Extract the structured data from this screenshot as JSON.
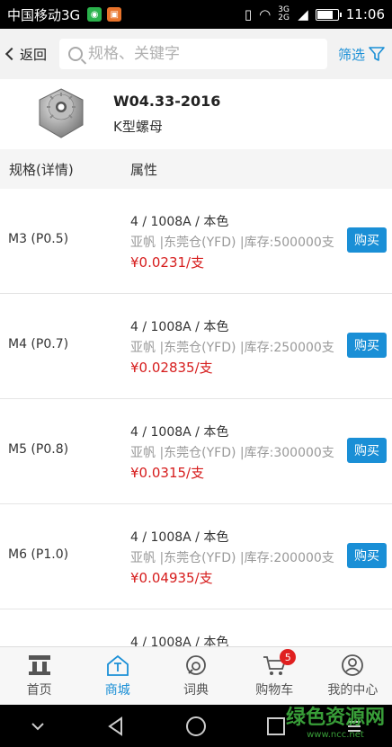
{
  "status": {
    "carrier": "中国移动3G",
    "network": "3G 2G",
    "time": "11:06",
    "battery_level": 0.8
  },
  "header": {
    "back_label": "返回",
    "search_placeholder": "规格、关键字",
    "filter_label": "筛选"
  },
  "product": {
    "code": "W04.33-2016",
    "name": "K型螺母"
  },
  "table": {
    "col_spec": "规格(详情)",
    "col_attr": "属性",
    "rows": [
      {
        "spec": "M3 (P0.5)",
        "attr": "4 / 1008A / 本色",
        "supplier": "亚帆 |东莞仓(YFD) |库存:500000支",
        "price": "¥0.0231/支",
        "buy": "购买"
      },
      {
        "spec": "M4 (P0.7)",
        "attr": "4 / 1008A / 本色",
        "supplier": "亚帆 |东莞仓(YFD) |库存:250000支",
        "price": "¥0.02835/支",
        "buy": "购买"
      },
      {
        "spec": "M5 (P0.8)",
        "attr": "4 / 1008A / 本色",
        "supplier": "亚帆 |东莞仓(YFD) |库存:300000支",
        "price": "¥0.0315/支",
        "buy": "购买"
      },
      {
        "spec": "M6 (P1.0)",
        "attr": "4 / 1008A / 本色",
        "supplier": "亚帆 |东莞仓(YFD) |库存:200000支",
        "price": "¥0.04935/支",
        "buy": "购买"
      },
      {
        "spec": "",
        "attr": "4 / 1008A / 本色",
        "supplier": "",
        "price": "",
        "buy": ""
      }
    ]
  },
  "tabs": [
    {
      "label": "首页",
      "icon": "home-icon"
    },
    {
      "label": "商城",
      "icon": "mall-icon"
    },
    {
      "label": "词典",
      "icon": "dictionary-icon"
    },
    {
      "label": "购物车",
      "icon": "cart-icon",
      "badge": "5"
    },
    {
      "label": "我的中心",
      "icon": "user-icon"
    }
  ],
  "watermark": {
    "text": "绿色资源网",
    "sub": "www.ncc.net"
  },
  "colors": {
    "accent": "#1a8fd6",
    "price": "#d61c1c",
    "badge": "#e02020"
  }
}
